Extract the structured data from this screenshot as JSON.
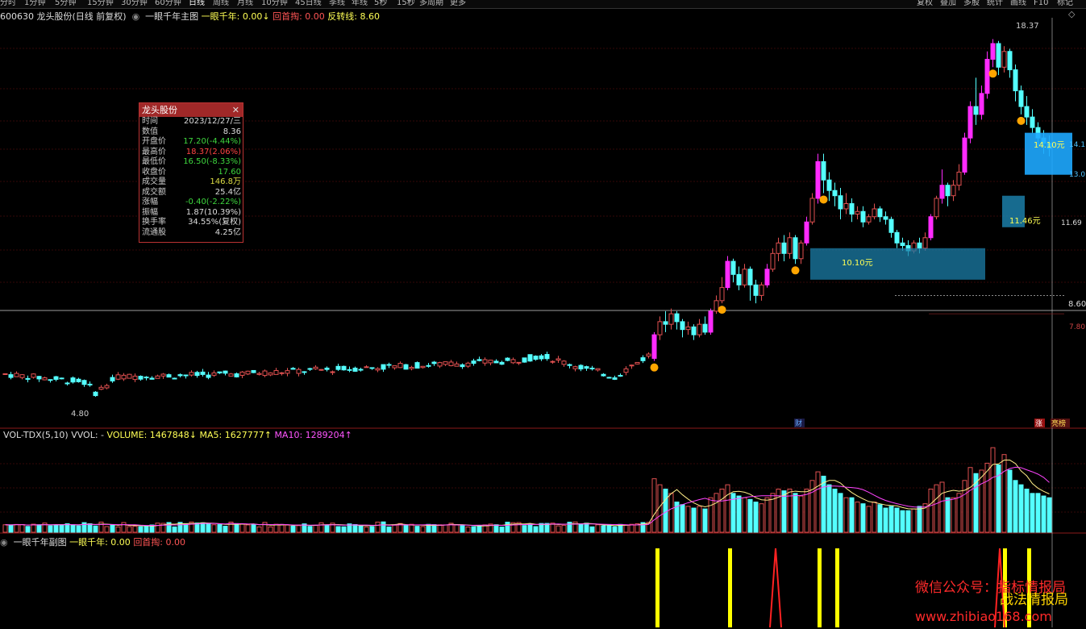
{
  "toolbar": {
    "periods": [
      "分时",
      "1分钟",
      "5分钟",
      "15分钟",
      "30分钟",
      "60分钟",
      "日线",
      "周线",
      "月线",
      "10分钟",
      "45日线",
      "季线",
      "年线",
      "5秒",
      "15秒",
      "多周期",
      "更多"
    ],
    "active_period": "日线",
    "right_buttons": [
      "复权",
      "叠加",
      "多股",
      "统计",
      "画线",
      "F10",
      "标记"
    ]
  },
  "main_header": {
    "stock": "600630 龙头股份(日线 前复权)",
    "indicator_name": "一眼千年主图",
    "line1": "一眼千年: 0.00↓",
    "line2": "回首掏: 0.00",
    "line3": "反转线: 8.60"
  },
  "price_labels": {
    "high": "18.37",
    "low": "4.80",
    "cursor_price": "8.60",
    "right_15": "14.1",
    "right_13": "13.0",
    "right_11": "11.69",
    "right_7": "7.80",
    "box_label_1": "10.10元",
    "box_label_2": "11.46元",
    "box_label_3": "14.10元"
  },
  "event_tags": {
    "cai": "财",
    "zhang": "涨",
    "liang": "亮榜"
  },
  "tooltip": {
    "title": "龙头股份",
    "close_icon": "✕",
    "rows": [
      {
        "k": "时间",
        "v": "2023/12/27/三",
        "color": "#dddddd"
      },
      {
        "k": "数值",
        "v": "8.36",
        "color": "#dddddd"
      },
      {
        "k": "开盘价",
        "v": "17.20(-4.44%)",
        "color": "#3ed63e"
      },
      {
        "k": "最高价",
        "v": "18.37(2.06%)",
        "color": "#ff4444"
      },
      {
        "k": "最低价",
        "v": "16.50(-8.33%)",
        "color": "#3ed63e"
      },
      {
        "k": "收盘价",
        "v": "17.60",
        "color": "#3ed63e"
      },
      {
        "k": "成交量",
        "v": "146.8万",
        "color": "#dddd44"
      },
      {
        "k": "成交额",
        "v": "25.4亿",
        "color": "#dddddd"
      },
      {
        "k": "涨幅",
        "v": "-0.40(-2.22%)",
        "color": "#3ed63e"
      },
      {
        "k": "振幅",
        "v": "1.87(10.39%)",
        "color": "#dddddd"
      },
      {
        "k": "换手率",
        "v": "34.55%(复权)",
        "color": "#dddddd"
      },
      {
        "k": "流通股",
        "v": "4.25亿",
        "color": "#dddddd"
      }
    ]
  },
  "vol_header": {
    "name": "VOL-TDX(5,10)",
    "vvol": "VVOL: -",
    "volume": "VOLUME: 1467848↓",
    "ma5": "MA5: 1627777↑",
    "ma10": "MA10: 1289204↑"
  },
  "sub_header": {
    "name": "一眼千年副图",
    "line1": "一眼千年: 0.00",
    "line2": "回首掏: 0.00"
  },
  "watermark": {
    "line1": "微信公众号：指标情报局",
    "line2": "战法情报局",
    "line3": "www.zhibiao168.com"
  },
  "colors": {
    "up": "#e05050",
    "down": "#54ffff",
    "signal": "#ff2bff",
    "box": "#1a90c0",
    "yellow": "#ffff00",
    "grid": "#6b1010"
  }
}
